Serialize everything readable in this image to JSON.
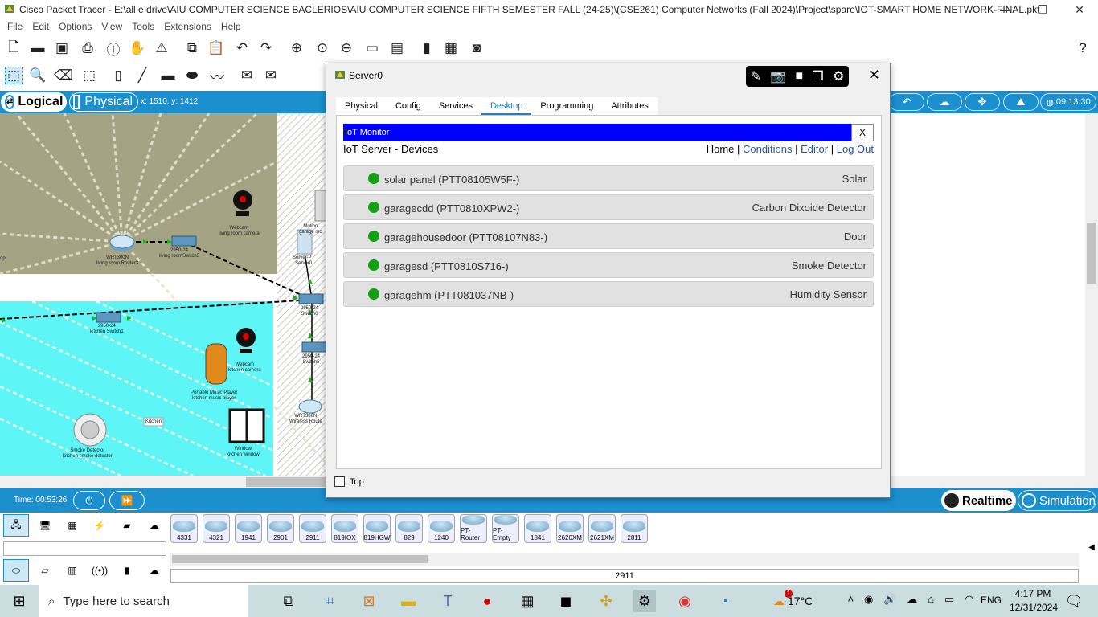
{
  "window": {
    "title": "Cisco Packet Tracer - E:\\all e drive\\AIU COMPUTER SCIENCE BACLERIOS\\AIU COMPUTER SCIENCE FIFTH SEMESTER FALL (24-25)\\(CSE261) Computer Networks (Fall 2024)\\Project\\spare\\IOT-SMART HOME NETWORK-FINAL.pkt"
  },
  "menu": [
    "File",
    "Edit",
    "Options",
    "View",
    "Tools",
    "Extensions",
    "Help"
  ],
  "modebar": {
    "logical": "Logical",
    "physical": "Physical",
    "coords": "x: 1510, y: 1412",
    "clock": "09:13:30"
  },
  "workspace": {
    "labels": {
      "webcam_lr": "Webcam\nliving room camera",
      "router_lr": "WRT300N\nliving room Router3",
      "switch_lr": "2950-24\nliving roomSwitch3",
      "motion": "Motion\ngarage mo",
      "server": "Server-PT\nServer0",
      "switch0": "2950-24\nSwitch0",
      "switch_kitchen": "2950-24\nkitchen Switch1",
      "webcam_k": "Webcam\nkitchen camera",
      "switch5": "2950-24\nSwitch5",
      "music": "Portable Music Player\nkitchen music player",
      "router_w": "WRT300N\nWireless Route",
      "kitchen": "Kitchen",
      "smoke": "Smoke Detector\nkitchen smoke detector",
      "window": "Window\nkitchen window",
      "edge": "op"
    }
  },
  "timebar": {
    "time": "Time: 00:53:26",
    "realtime": "Realtime",
    "simulation": "Simulation"
  },
  "devices": {
    "models": [
      "4331",
      "4321",
      "1941",
      "2901",
      "2911",
      "819IOX",
      "819HGW",
      "829",
      "1240",
      "PT-Router",
      "PT-Empty",
      "1841",
      "2620XM",
      "2621XM",
      "2811"
    ],
    "selected_label": "2911"
  },
  "dialog": {
    "title": "Server0",
    "tabs": [
      "Physical",
      "Config",
      "Services",
      "Desktop",
      "Programming",
      "Attributes"
    ],
    "active_tab": "Desktop",
    "iot": {
      "header": "IoT Monitor",
      "close": "X",
      "subtitle": "IoT Server - Devices",
      "nav": {
        "home": "Home",
        "conditions": "Conditions",
        "editor": "Editor",
        "logout": "Log Out",
        "sep": "|"
      },
      "devices": [
        {
          "name": "solar panel (PTT08105W5F-)",
          "type": "Solar"
        },
        {
          "name": "garagecdd (PTT0810XPW2-)",
          "type": "Carbon Dixoide Detector"
        },
        {
          "name": "garagehousedoor (PTT08107N83-)",
          "type": "Door"
        },
        {
          "name": "garagesd (PTT0810S716-)",
          "type": "Smoke Detector"
        },
        {
          "name": "garagehm (PTT081037NB-)",
          "type": "Humidity Sensor"
        }
      ]
    },
    "top_checkbox": "Top"
  },
  "taskbar": {
    "search_placeholder": "Type here to search",
    "weather": "17°C",
    "language": "ENG",
    "time": "4:17 PM",
    "date": "12/31/2024",
    "weather_badge": "1"
  },
  "colors": {
    "accent_blue": "#1c8fcf",
    "iot_header": "#0000ff",
    "status_green": "#13a013",
    "workspace_olive": "#a4a384",
    "workspace_cyan": "#5ef5f7"
  }
}
